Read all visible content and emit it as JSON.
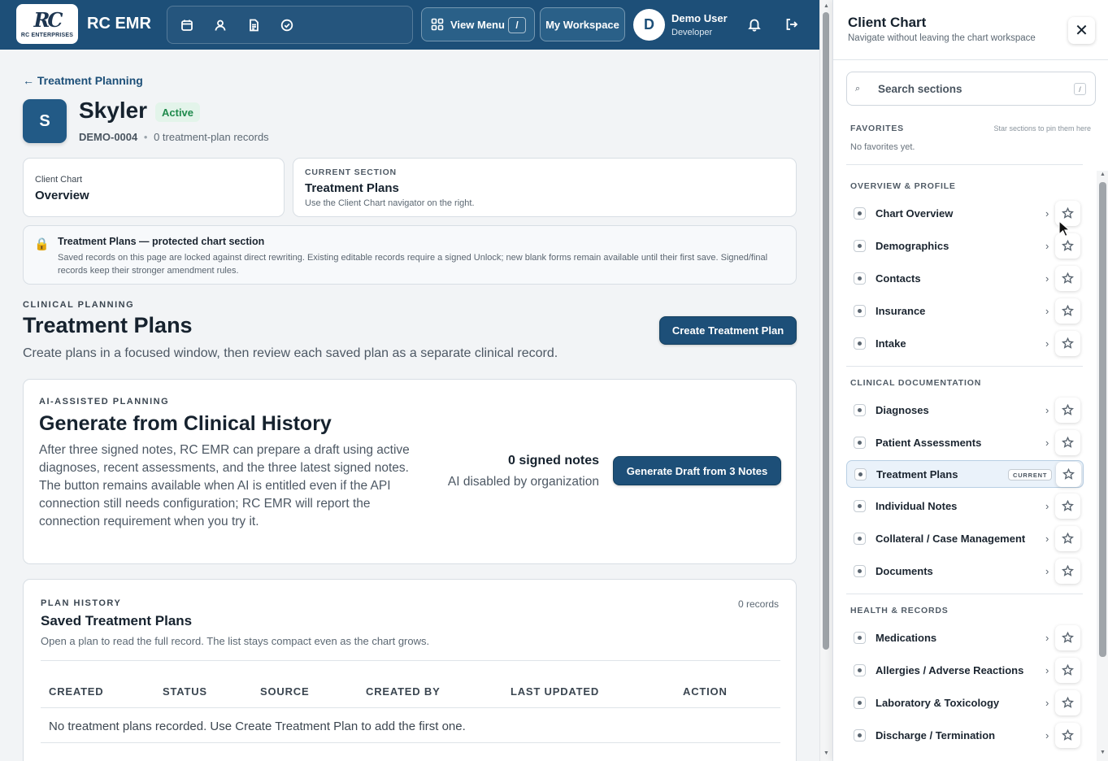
{
  "app": {
    "brand": "RC EMR",
    "logo_mark": "RC",
    "logo_sub": "RC ENTERPRISES",
    "view_menu_label": "View Menu",
    "view_menu_shortcut": "/",
    "workspace_label": "My Workspace",
    "user": {
      "initial": "D",
      "name": "Demo User",
      "role": "Developer"
    },
    "colors": {
      "primary": "#1d4f78",
      "active_green": "#1f8a4c"
    },
    "icons": [
      "calendar-icon",
      "user-icon",
      "document-icon",
      "check-circle-icon",
      "grid-icon",
      "bell-icon",
      "logout-icon"
    ]
  },
  "main": {
    "back_link": "← Treatment Planning",
    "client": {
      "initial": "S",
      "name": "Skyler",
      "status": "Active",
      "id": "DEMO-0004",
      "separator": "•",
      "records": "0 treatment-plan records"
    },
    "nav_card": {
      "label": "Client Chart",
      "value": "Overview"
    },
    "current_section": {
      "label": "CURRENT SECTION",
      "value": "Treatment Plans",
      "hint": "Use the Client Chart navigator on the right."
    },
    "lock_note": {
      "title": "Treatment Plans — protected chart section",
      "body": "Saved records on this page are locked against direct rewriting. Existing editable records require a signed Unlock; new blank forms remain available until their first save. Signed/final records keep their stronger amendment rules."
    },
    "section": {
      "eyebrow": "CLINICAL PLANNING",
      "title": "Treatment Plans",
      "subtitle": "Create plans in a focused window, then review each saved plan as a separate clinical record.",
      "create_button": "Create Treatment Plan"
    },
    "ai": {
      "eyebrow": "AI-ASSISTED PLANNING",
      "title": "Generate from Clinical History",
      "description": "After three signed notes, RC EMR can prepare a draft using active diagnoses, recent assessments, and the three latest signed notes. The button remains available when AI is entitled even if the API connection still needs configuration; RC EMR will report the connection requirement when you try it.",
      "signed_notes": "0 signed notes",
      "status": "AI disabled by organization",
      "button": "Generate Draft from 3 Notes"
    },
    "history": {
      "eyebrow": "PLAN HISTORY",
      "count": "0 records",
      "title": "Saved Treatment Plans",
      "subtitle": "Open a plan to read the full record. The list stays compact even as the chart grows.",
      "columns": [
        "CREATED",
        "STATUS",
        "SOURCE",
        "CREATED BY",
        "LAST UPDATED",
        "ACTION"
      ],
      "empty": "No treatment plans recorded. Use Create Treatment Plan to add the first one."
    }
  },
  "drawer": {
    "title": "Client Chart",
    "subtitle": "Navigate without leaving the chart workspace",
    "close": "✕",
    "search_placeholder": "Search sections",
    "search_shortcut": "/",
    "favorites": {
      "heading": "FAVORITES",
      "hint": "Star sections to pin them here",
      "empty": "No favorites yet."
    },
    "groups": [
      {
        "heading": "OVERVIEW & PROFILE",
        "items": [
          "Chart Overview",
          "Demographics",
          "Contacts",
          "Insurance",
          "Intake"
        ]
      },
      {
        "heading": "CLINICAL DOCUMENTATION",
        "items": [
          "Diagnoses",
          "Patient Assessments",
          "Treatment Plans",
          "Individual Notes",
          "Collateral / Case Management",
          "Documents"
        ]
      },
      {
        "heading": "HEALTH & RECORDS",
        "items": [
          "Medications",
          "Allergies / Adverse Reactions",
          "Laboratory & Toxicology",
          "Discharge / Termination"
        ]
      }
    ],
    "current_badge": "CURRENT"
  }
}
